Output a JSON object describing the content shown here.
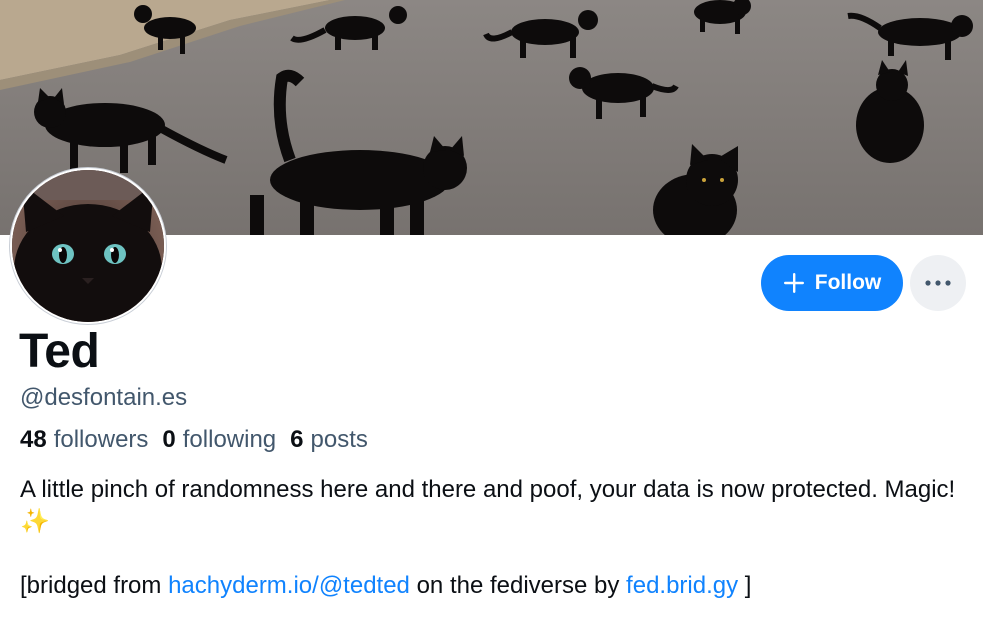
{
  "profile": {
    "display_name": "Ted",
    "handle": "@desfontain.es",
    "stats": {
      "followers_count": "48",
      "followers_label": "followers",
      "following_count": "0",
      "following_label": "following",
      "posts_count": "6",
      "posts_label": "posts"
    },
    "bio": {
      "line1": "A little pinch of randomness here and there and poof, your data is now protected. Magic! ✨",
      "line2_prefix": "[bridged from ",
      "line2_link1": "hachyderm.io/@tedted",
      "line2_middle": " on the fediverse by ",
      "line2_link2": "fed.brid.gy",
      "line2_suffix": " ]"
    }
  },
  "actions": {
    "follow_label": "Follow",
    "follow_icon": "plus-icon",
    "more_icon": "ellipsis-icon"
  },
  "colors": {
    "accent": "#1083fe",
    "muted_text": "#42576c",
    "more_button_bg": "#eef0f3"
  }
}
